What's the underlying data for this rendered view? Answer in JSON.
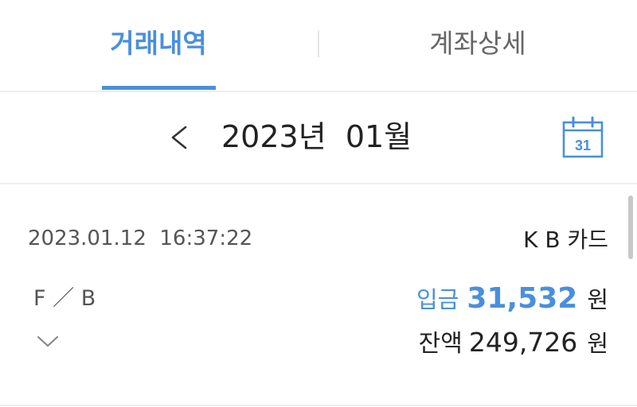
{
  "tabs": [
    {
      "label": "거래내역",
      "active": true
    },
    {
      "label": "계좌상세",
      "active": false
    }
  ],
  "month_nav": {
    "year": "2023년",
    "month": "01월",
    "calendar_day": "31"
  },
  "transactions": [
    {
      "datetime": "2023.01.12  16:37:22",
      "merchant": "K B 카드",
      "memo": "F ／ B",
      "type": "입금",
      "amount": "31,532",
      "amount_unit": "원",
      "balance_label": "잔액",
      "balance": "249,726",
      "balance_unit": "원"
    }
  ],
  "colors": {
    "accent": "#4a8fdc",
    "text": "#222222",
    "muted": "#555555",
    "divider": "#eeeeee"
  },
  "icons": [
    "chevron-left-icon",
    "calendar-icon",
    "chevron-down-icon"
  ]
}
